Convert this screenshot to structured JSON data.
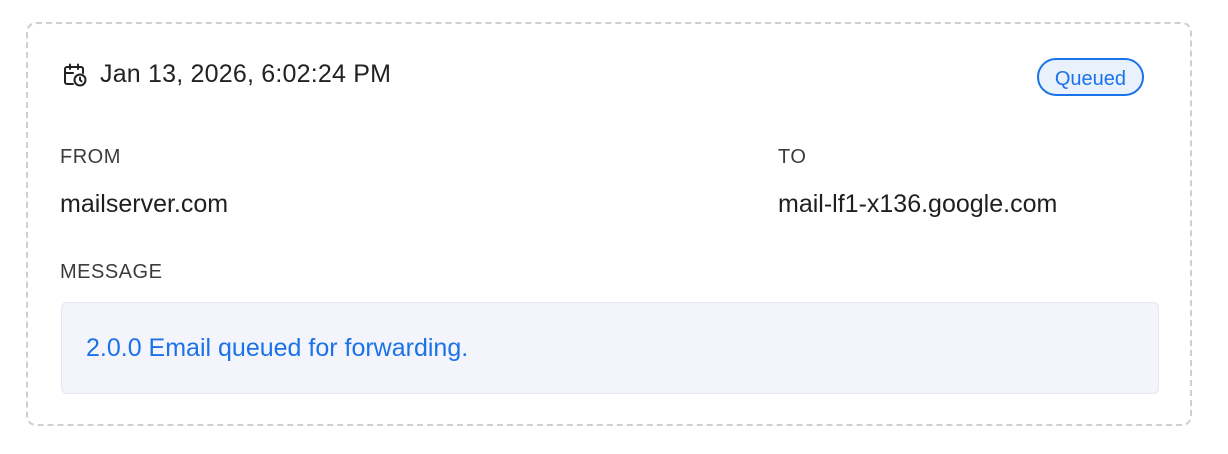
{
  "log_entry": {
    "timestamp": "Jan 13, 2026, 6:02:24 PM",
    "status": "Queued",
    "from_label": "FROM",
    "from_value": "mailserver.com",
    "to_label": "TO",
    "to_value": "mail-lf1-x136.google.com",
    "message_label": "MESSAGE",
    "message_text": "2.0.0 Email queued for forwarding."
  },
  "icons": {
    "timestamp_icon": "calendar-clock-icon"
  },
  "colors": {
    "accent": "#1a73e8",
    "badge_bg": "#e8f1fc",
    "message_bg": "#f3f4fc",
    "card_border": "#cfcfcf"
  }
}
